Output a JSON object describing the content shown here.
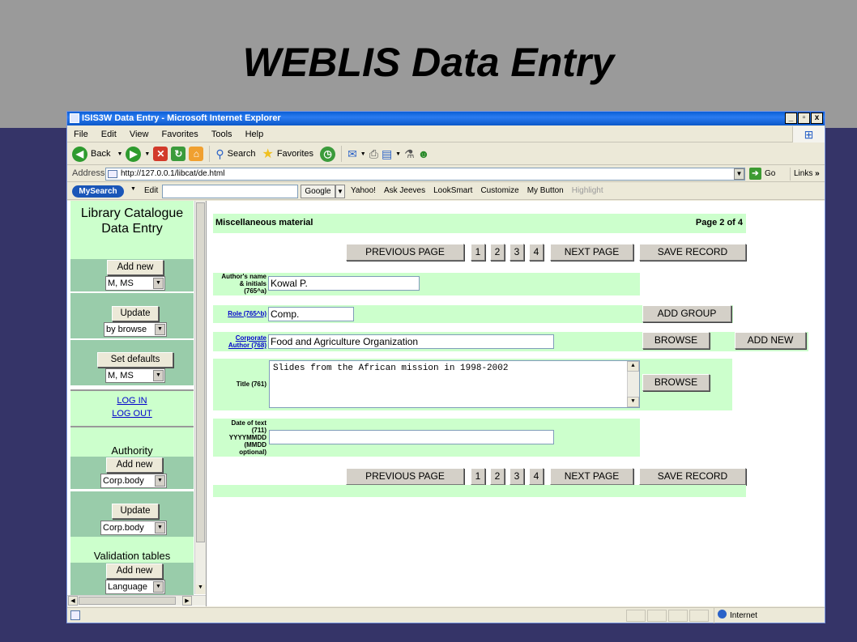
{
  "slide": {
    "title": "WEBLIS Data Entry"
  },
  "window": {
    "title": "ISIS3W Data Entry - Microsoft Internet Explorer",
    "controls": [
      "_",
      "▫",
      "x"
    ]
  },
  "menu": [
    "File",
    "Edit",
    "View",
    "Favorites",
    "Tools",
    "Help"
  ],
  "toolbar": {
    "back": "Back",
    "search": "Search",
    "favorites": "Favorites"
  },
  "address": {
    "label": "Address",
    "url": "http://127.0.0.1/libcat/de.html",
    "go": "Go",
    "links": "Links"
  },
  "searchbar": {
    "brand": "MySearch",
    "edit": "Edit",
    "engine": "Google",
    "items": [
      "Yahoo!",
      "Ask Jeeves",
      "LookSmart",
      "Customize",
      "My Button"
    ],
    "highlight": "Highlight"
  },
  "left": {
    "heading1": "Library Catalogue",
    "heading2": "Data Entry",
    "add_new": "Add new",
    "add_new_select": "M, MS",
    "update": "Update",
    "update_select": "by browse",
    "set_defaults": "Set defaults",
    "defaults_select": "M, MS",
    "login": "LOG IN",
    "logout": "LOG OUT",
    "authority": "Authority",
    "auth_add_new": "Add new",
    "auth_add_select": "Corp.body",
    "auth_update": "Update",
    "auth_update_select": "Corp.body",
    "validation": "Validation tables",
    "val_add_new": "Add new",
    "val_select": "Language"
  },
  "form": {
    "section": "Miscellaneous material",
    "page": "Page 2 of 4",
    "nav": {
      "prev": "PREVIOUS PAGE",
      "pages": [
        "1",
        "2",
        "3",
        "4"
      ],
      "next": "NEXT PAGE",
      "save": "SAVE RECORD"
    },
    "author_label": [
      "Author's name",
      "& initials",
      "(765^a)"
    ],
    "author_value": "Kowal P.",
    "role_label": "Role (765^b)",
    "role_value": "Comp.",
    "add_group": "ADD GROUP",
    "corp_label": [
      "Corporate",
      "Author (768)"
    ],
    "corp_value": "Food and Agriculture Organization",
    "browse": "BROWSE",
    "add_new": "ADD NEW",
    "title_label": "Title (761)",
    "title_value": "Slides from the African mission in 1998-2002",
    "date_label": [
      "Date of text",
      "(711)",
      "YYYYMMDD",
      "(MMDD",
      "optional)"
    ],
    "date_value": ""
  },
  "status": {
    "zone": "Internet"
  },
  "colors": {
    "panel_green": "#ccffcc",
    "block_green": "#99ccaa",
    "slide_blue": "#353468",
    "slide_grey": "#9a9a9a"
  }
}
